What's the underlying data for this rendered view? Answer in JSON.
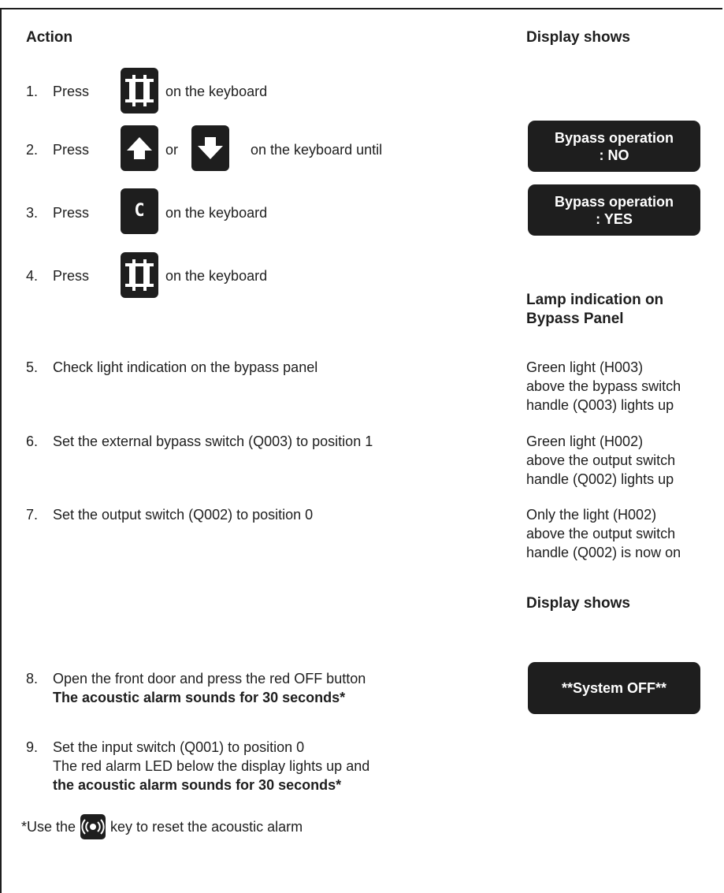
{
  "headers": {
    "action": "Action",
    "display_shows": "Display shows",
    "lamp_indication": "Lamp indication on Bypass Panel",
    "display_shows_2": "Display shows"
  },
  "steps": [
    {
      "num": "1.",
      "press": "Press",
      "after": "on the keyboard"
    },
    {
      "num": "2.",
      "press": "Press",
      "or": "or",
      "after": "on the keyboard until"
    },
    {
      "num": "3.",
      "press": "Press",
      "after": "on the keyboard",
      "key_label": "C"
    },
    {
      "num": "4.",
      "press": "Press",
      "after": "on the keyboard"
    },
    {
      "num": "5.",
      "text": "Check light indication on the bypass panel"
    },
    {
      "num": "6.",
      "text": "Set the external bypass switch (Q003) to position 1"
    },
    {
      "num": "7.",
      "text": "Set the output switch (Q002) to position 0"
    },
    {
      "num": "8.",
      "line1": "Open the front door and press the red OFF button",
      "line2": "The acoustic alarm sounds for 30 seconds*"
    },
    {
      "num": "9.",
      "line1": "Set the input switch (Q001) to position 0",
      "line2": "The red alarm LED below the display lights up and",
      "line3": "the acoustic alarm sounds for 30 seconds*"
    }
  ],
  "displays": {
    "bypass_no": {
      "line1": "Bypass operation",
      "line2": ": NO"
    },
    "bypass_yes": {
      "line1": "Bypass operation",
      "line2": ": YES"
    },
    "system_off": "**System OFF**"
  },
  "lamps": [
    {
      "line1": "Green light (H003)",
      "line2": "above the bypass switch",
      "line3": "handle (Q003) lights up"
    },
    {
      "line1": "Green light (H002)",
      "line2": "above the output switch",
      "line3": "handle (Q002) lights up"
    },
    {
      "line1": "Only the light (H002)",
      "line2": "above the output switch",
      "line3": "handle (Q002) is now on"
    }
  ],
  "footnote": {
    "before": "*Use the",
    "after": "key  to reset the acoustic alarm"
  },
  "icons": {
    "menu_key": "frame-icon",
    "up_key": "arrow-up-icon",
    "down_key": "arrow-down-icon",
    "alarm_key": "alarm-reset-icon"
  },
  "colors": {
    "ink": "#1e1e1e",
    "background": "#ffffff"
  }
}
